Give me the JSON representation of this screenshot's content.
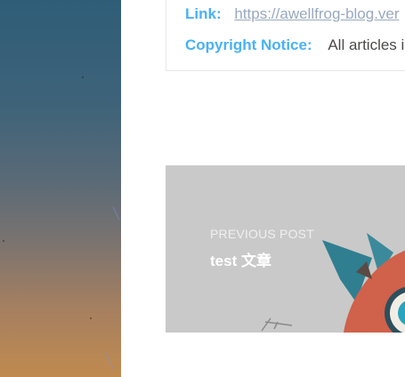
{
  "post_copyright": {
    "link_label": "Link:",
    "link_url": "https://awellfrog-blog.vercel.app",
    "link_visible": "https://awellfrog-blog.ver",
    "notice_label": "Copyright Notice:",
    "notice_text": "All articles in"
  },
  "pagination": {
    "prev_caption": "Previous Post",
    "prev_title": "test 文章"
  },
  "colors": {
    "accent": "#49b1f5",
    "link": "#99a9bf",
    "body_text": "#4c4948",
    "card_bg": "#c8c8c8"
  }
}
